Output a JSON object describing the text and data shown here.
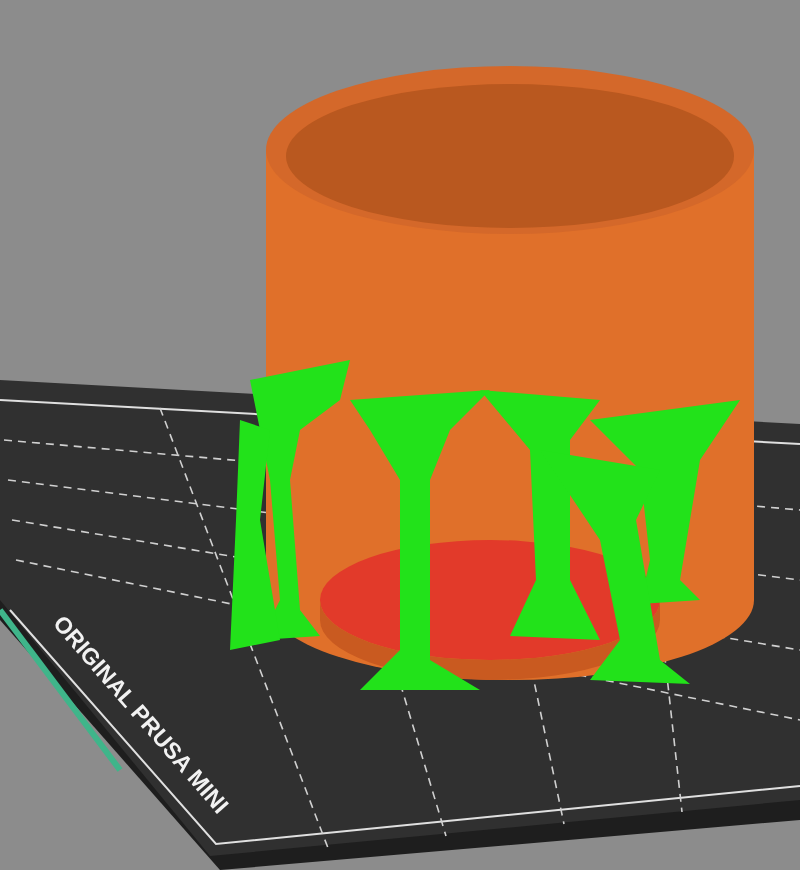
{
  "viewport": {
    "bed_label": "ORIGINAL PRUSA MINI"
  }
}
